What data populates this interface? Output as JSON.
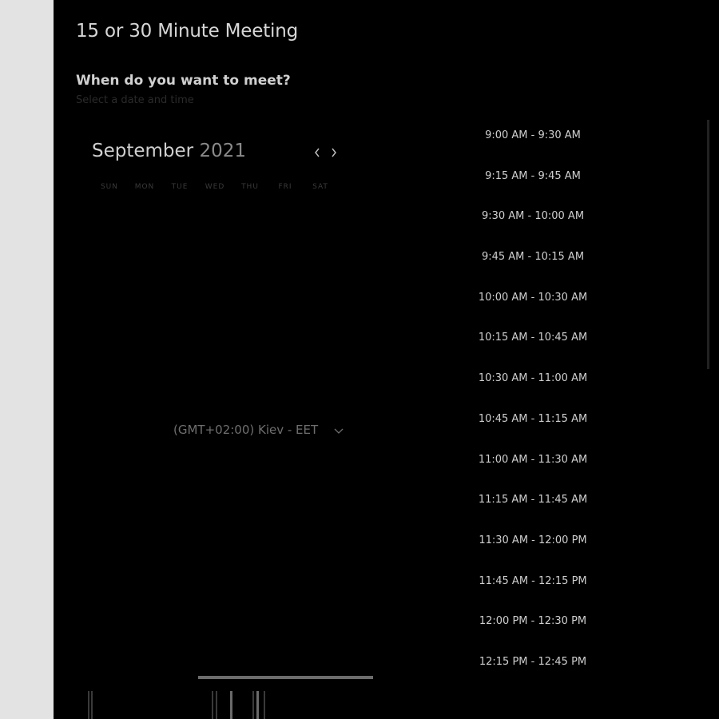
{
  "meeting": {
    "title": "15 or 30 Minute Meeting",
    "question": "When do you want to meet?",
    "subtitle": "Select a date and time"
  },
  "calendar": {
    "month": "September",
    "year": "2021",
    "prev_icon": "chevron-left-icon",
    "next_icon": "chevron-right-icon",
    "weekdays": [
      "SUN",
      "MON",
      "TUE",
      "WED",
      "THU",
      "FRI",
      "SAT"
    ]
  },
  "timezone": {
    "value": "(GMT+02:00) Kiev - EET",
    "chevron_icon": "chevron-down-icon"
  },
  "time_slots": [
    "9:00 AM - 9:30 AM",
    "9:15 AM - 9:45 AM",
    "9:30 AM - 10:00 AM",
    "9:45 AM - 10:15 AM",
    "10:00 AM - 10:30 AM",
    "10:15 AM - 10:45 AM",
    "10:30 AM - 11:00 AM",
    "10:45 AM - 11:15 AM",
    "11:00 AM - 11:30 AM",
    "11:15 AM - 11:45 AM",
    "11:30 AM - 12:00 PM",
    "11:45 AM - 12:15 PM",
    "12:00 PM - 12:30 PM",
    "12:15 PM - 12:45 PM"
  ],
  "colors": {
    "panel_background": "#000000",
    "page_background": "#e3e3e3",
    "text_primary": "#cfcfcf"
  }
}
